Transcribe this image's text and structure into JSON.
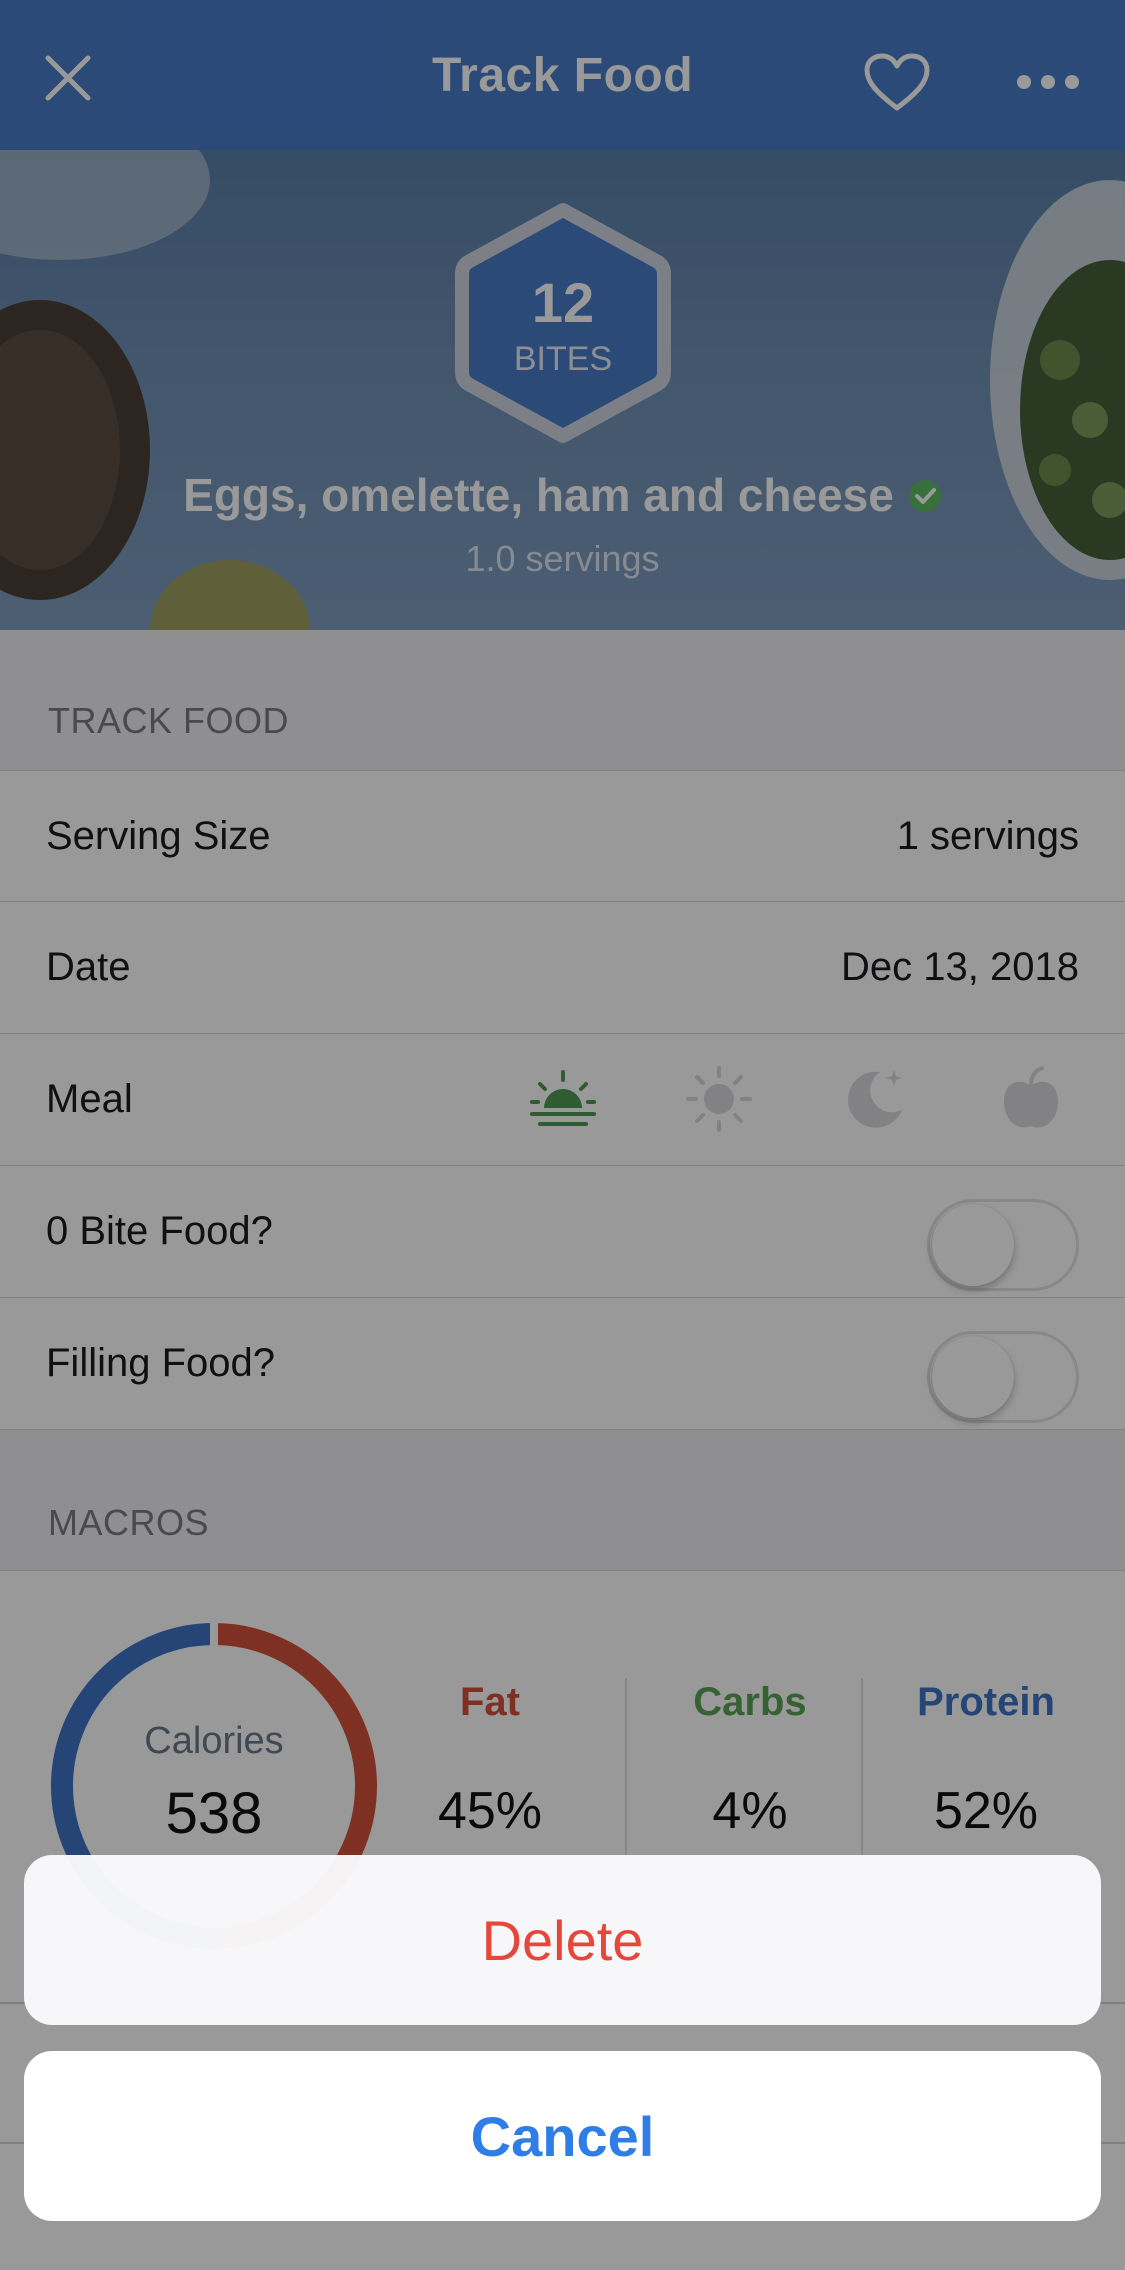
{
  "header": {
    "title": "Track Food",
    "close_icon": "close-icon",
    "favorite_icon": "heart-icon",
    "more_icon": "more-icon",
    "bar_color": "#4a7cc9"
  },
  "food": {
    "bites_value": "12",
    "bites_label": "BITES",
    "name": "Eggs, omelette, ham and cheese",
    "verified_icon": "verified-check-icon",
    "servings_text": "1.0 servings"
  },
  "track_food": {
    "section_title": "TRACK FOOD",
    "serving_size": {
      "label": "Serving Size",
      "value": "1 servings"
    },
    "date": {
      "label": "Date",
      "value": "Dec 13, 2018"
    },
    "meal": {
      "label": "Meal",
      "options": [
        {
          "icon": "sunrise-icon",
          "name": "Breakfast",
          "selected": true
        },
        {
          "icon": "sun-icon",
          "name": "Lunch",
          "selected": false
        },
        {
          "icon": "moon-icon",
          "name": "Dinner",
          "selected": false
        },
        {
          "icon": "apple-icon",
          "name": "Snack",
          "selected": false
        }
      ],
      "selected_color": "#4f9a52"
    },
    "zero_bite": {
      "label": "0 Bite Food?",
      "on": false
    },
    "filling": {
      "label": "Filling Food?",
      "on": false
    }
  },
  "macros": {
    "section_title": "MACROS",
    "calories_label": "Calories",
    "calories_value": "538",
    "fat": {
      "label": "Fat",
      "value": "45%",
      "color": "#d2533a"
    },
    "carbs": {
      "label": "Carbs",
      "value": "4%",
      "color": "#5aa455"
    },
    "protein": {
      "label": "Protein",
      "value": "52%",
      "color": "#3f73c7"
    }
  },
  "action_sheet": {
    "delete_label": "Delete",
    "cancel_label": "Cancel",
    "delete_color": "#e5483a",
    "cancel_color": "#2f7ee8"
  }
}
